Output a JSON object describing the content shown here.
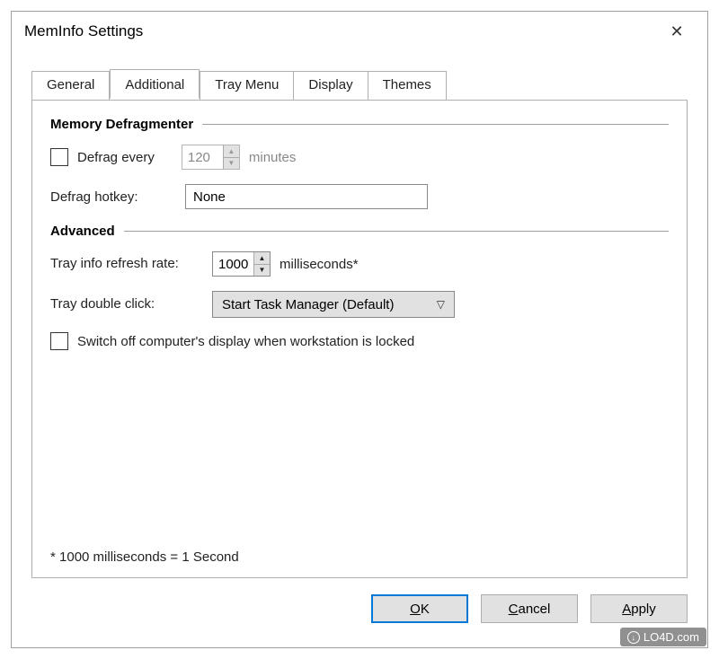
{
  "window": {
    "title": "MemInfo Settings"
  },
  "tabs": {
    "items": [
      {
        "label": "General"
      },
      {
        "label": "Additional"
      },
      {
        "label": "Tray Menu"
      },
      {
        "label": "Display"
      },
      {
        "label": "Themes"
      }
    ],
    "active_index": 1
  },
  "sections": {
    "memory_defragmenter": {
      "title": "Memory Defragmenter",
      "defrag_every": {
        "checked": false,
        "label": "Defrag every",
        "value": "120",
        "unit": "minutes"
      },
      "defrag_hotkey": {
        "label": "Defrag hotkey:",
        "value": "None"
      }
    },
    "advanced": {
      "title": "Advanced",
      "refresh_rate": {
        "label": "Tray info refresh rate:",
        "value": "1000",
        "unit": "milliseconds*"
      },
      "tray_double_click": {
        "label": "Tray double click:",
        "value": "Start Task Manager (Default)"
      },
      "switch_off_display": {
        "checked": false,
        "label": "Switch off computer's display when workstation is locked"
      }
    }
  },
  "footnote": "* 1000 milliseconds = 1 Second",
  "actions": {
    "ok": "OK",
    "cancel": "Cancel",
    "apply": "Apply"
  },
  "watermark": "LO4D.com"
}
